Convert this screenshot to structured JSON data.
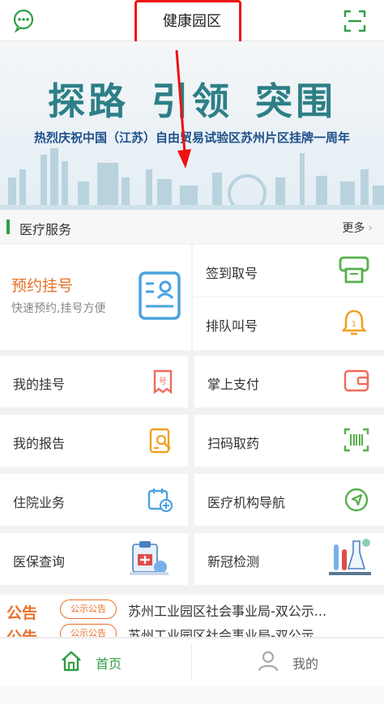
{
  "header": {
    "title": "健康园区"
  },
  "banner": {
    "slogan": "探路 引领 突围",
    "subtitle": "热烈庆祝中国（江苏）自由贸易试验区苏州片区挂牌一周年"
  },
  "medical_section": {
    "title": "医疗服务",
    "more_label": "更多"
  },
  "booking": {
    "title": "预约挂号",
    "subtitle": "快速预约,挂号方便"
  },
  "services": {
    "checkin": "签到取号",
    "queue": "排队叫号",
    "my_registration": "我的挂号",
    "mobile_payment": "掌上支付",
    "my_report": "我的报告",
    "scan_medicine": "扫码取药",
    "hospitalization": "住院业务",
    "navigation": "医疗机构导航",
    "insurance": "医保查询",
    "covid_test": "新冠检测"
  },
  "notice": {
    "label": "公告",
    "items": [
      {
        "badge": "公示公告",
        "text": "苏州工业园区社会事业局-双公示..."
      },
      {
        "badge": "公示公告",
        "text": "苏州工业园区社会事业局-双公示..."
      }
    ]
  },
  "tabs": {
    "home": "首页",
    "mine": "我的"
  },
  "colors": {
    "accent_green": "#2f9e44",
    "accent_orange": "#e8702a",
    "highlight_red": "#e11111"
  }
}
